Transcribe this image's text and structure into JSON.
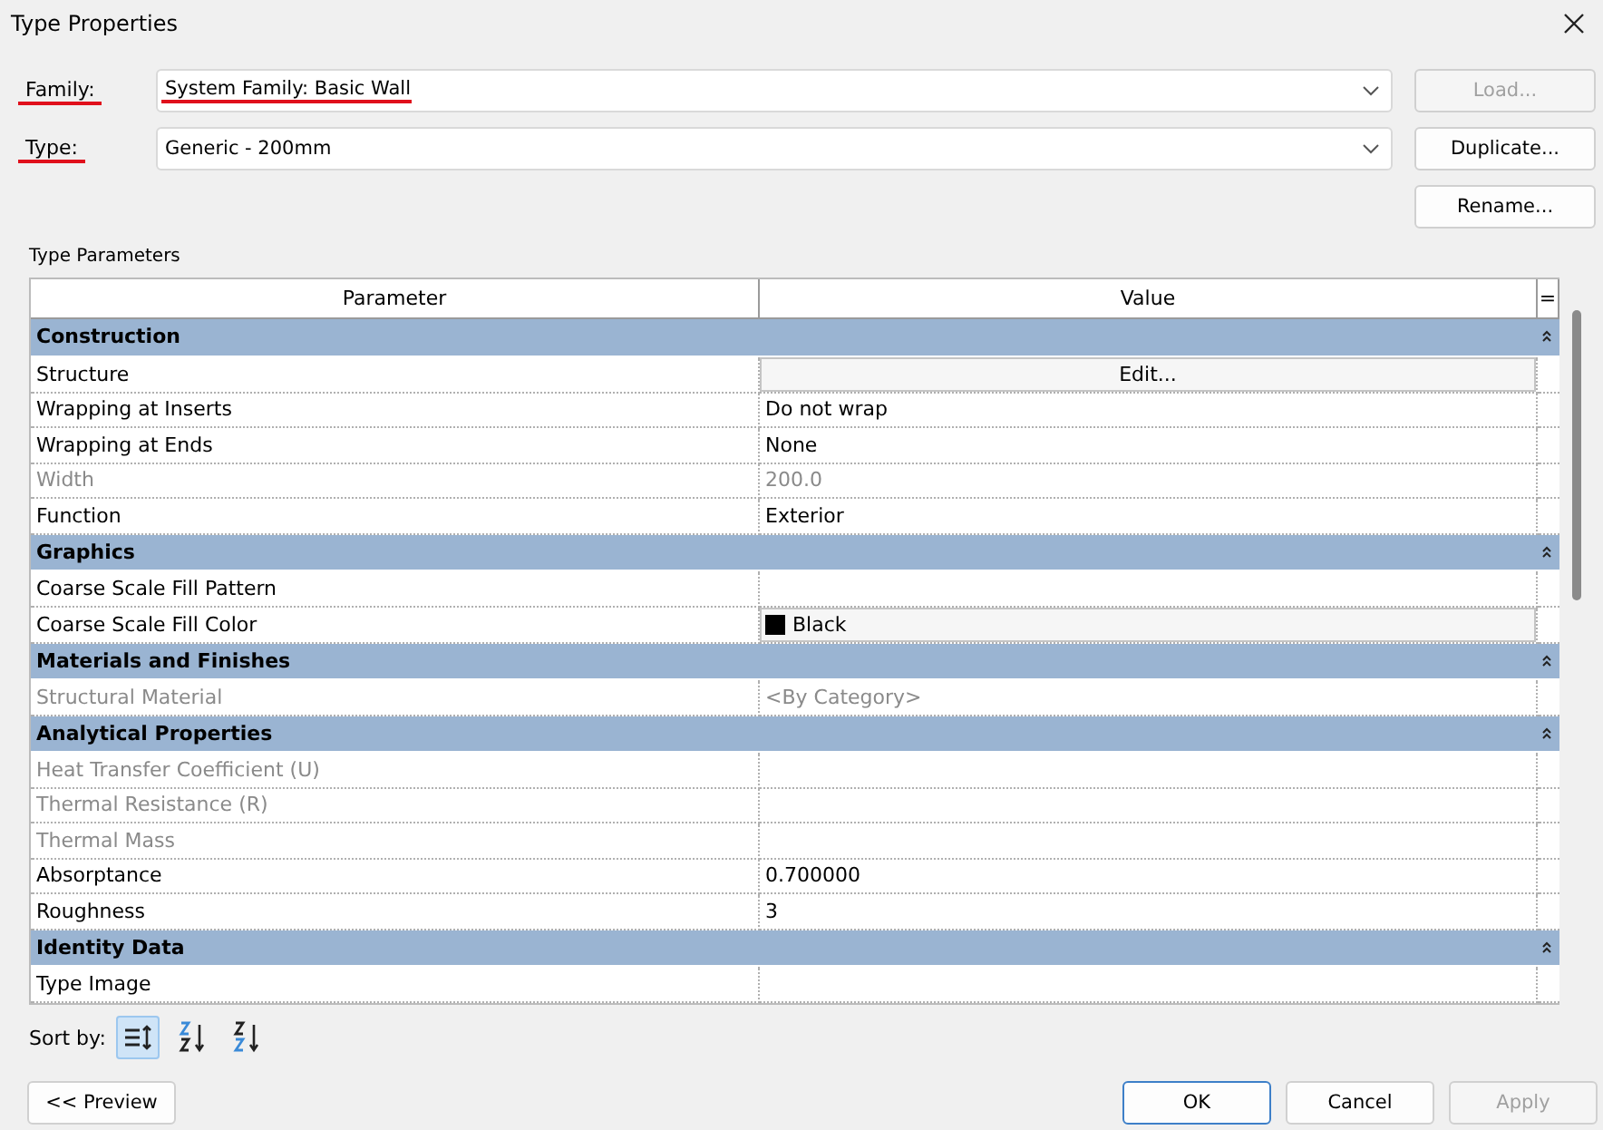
{
  "window": {
    "title": "Type Properties"
  },
  "family": {
    "label": "Family:",
    "value": "System Family: Basic Wall",
    "underlined": true
  },
  "type": {
    "label": "Type:",
    "value": "Generic - 200mm",
    "underlined": true
  },
  "side_buttons": [
    {
      "label": "Load...",
      "disabled": true
    },
    {
      "label": "Duplicate...",
      "disabled": false
    },
    {
      "label": "Rename...",
      "disabled": false
    }
  ],
  "section_label": "Type Parameters",
  "table": {
    "columns": [
      "Parameter",
      "Value",
      "="
    ],
    "rows": [
      {
        "kind": "group",
        "name": "Construction",
        "expanded": true
      },
      {
        "kind": "button",
        "name": "Structure",
        "value": "Edit...",
        "disabled": false
      },
      {
        "kind": "text",
        "name": "Wrapping at Inserts",
        "value": "Do not wrap",
        "disabled": false
      },
      {
        "kind": "text",
        "name": "Wrapping at Ends",
        "value": "None",
        "disabled": false
      },
      {
        "kind": "text",
        "name": "Width",
        "value": "200.0",
        "disabled": true
      },
      {
        "kind": "text",
        "name": "Function",
        "value": "Exterior",
        "disabled": false
      },
      {
        "kind": "group",
        "name": "Graphics",
        "expanded": true
      },
      {
        "kind": "text",
        "name": "Coarse Scale Fill Pattern",
        "disabled": false
      },
      {
        "kind": "color",
        "name": "Coarse Scale Fill Color",
        "value": "Black",
        "color": "#000000",
        "disabled": false
      },
      {
        "kind": "group",
        "name": "Materials and Finishes",
        "expanded": true
      },
      {
        "kind": "text",
        "name": "Structural Material",
        "value": "<By Category>",
        "disabled": true
      },
      {
        "kind": "group",
        "name": "Analytical Properties",
        "expanded": true
      },
      {
        "kind": "text",
        "name": "Heat Transfer Coefficient (U)",
        "disabled": true
      },
      {
        "kind": "text",
        "name": "Thermal Resistance (R)",
        "disabled": true
      },
      {
        "kind": "text",
        "name": "Thermal Mass",
        "disabled": true
      },
      {
        "kind": "text",
        "name": "Absorptance",
        "value": "0.700000",
        "disabled": false
      },
      {
        "kind": "text",
        "name": "Roughness",
        "value": "3",
        "disabled": false
      },
      {
        "kind": "group",
        "name": "Identity Data",
        "expanded": true
      },
      {
        "kind": "text",
        "name": "Type Image",
        "disabled": false
      }
    ]
  },
  "sort": {
    "label": "Sort by:",
    "options": [
      {
        "kind": "grouped",
        "selected": true
      },
      {
        "kind": "ascending",
        "selected": false
      },
      {
        "kind": "descending",
        "selected": false
      }
    ]
  },
  "preview_button": "<< Preview",
  "footer_buttons": [
    {
      "label": "OK",
      "default": true,
      "disabled": false
    },
    {
      "label": "Cancel",
      "default": false,
      "disabled": false
    },
    {
      "label": "Apply",
      "default": false,
      "disabled": true
    }
  ]
}
